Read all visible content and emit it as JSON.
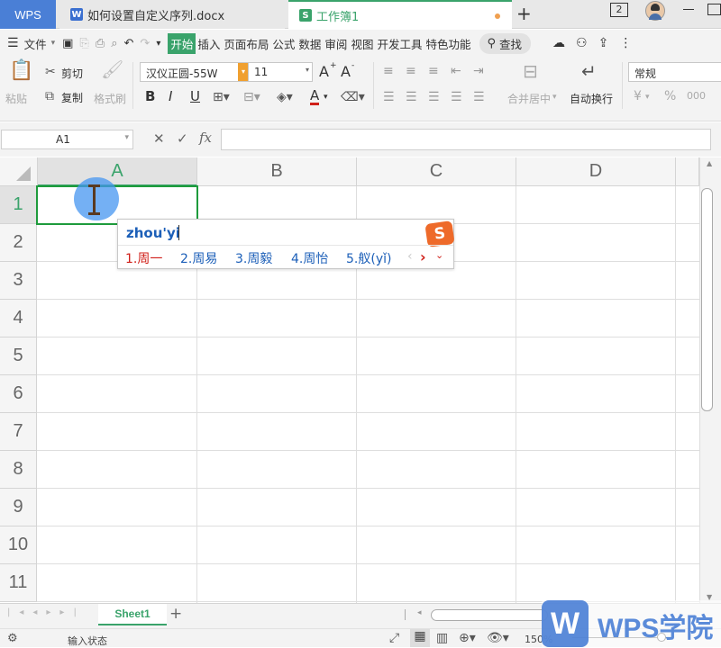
{
  "tabs": {
    "app": "WPS",
    "doc_icon": "W",
    "doc_title": "如何设置自定义序列.docx",
    "book_icon": "S",
    "book_title": "工作簿1",
    "new_tab": "+",
    "window_count": "2"
  },
  "menu": {
    "file": "文件",
    "items": [
      "开始",
      "插入",
      "页面布局",
      "公式",
      "数据",
      "审阅",
      "视图",
      "开发工具",
      "特色功能"
    ],
    "search": "查找"
  },
  "ribbon": {
    "paste": "粘贴",
    "cut": "剪切",
    "copy": "复制",
    "format_painter": "格式刷",
    "font_name": "汉仪正圆-55W",
    "font_size": "11",
    "bold": "B",
    "italic": "I",
    "underline": "U",
    "font_color_letter": "A",
    "merge_center": "合并居中",
    "wrap_text": "自动换行",
    "number_format": "常规",
    "currency": "¥",
    "percent": "%",
    "thousands": "000",
    "inc_font": "A",
    "dec_font": "A"
  },
  "formula_bar": {
    "name_box": "A1",
    "fx": "fx",
    "cancel": "✕",
    "confirm": "✓",
    "value": ""
  },
  "grid": {
    "columns": [
      "A",
      "B",
      "C",
      "D"
    ],
    "rows": [
      "1",
      "2",
      "3",
      "4",
      "5",
      "6",
      "7",
      "8",
      "9",
      "10",
      "11"
    ],
    "active_cell": "A1"
  },
  "ime": {
    "composition": "zhou'yi",
    "candidates": [
      "1.周一",
      "2.周易",
      "3.周毅",
      "4.周怡",
      "5.舣(yǐ)"
    ],
    "logo": "S"
  },
  "sheet_tabs": {
    "active": "Sheet1",
    "add": "+"
  },
  "status": {
    "mode": "输入状态",
    "zoom": "150%",
    "watermark": "WPS学院",
    "watermark_icon": "W"
  },
  "colors": {
    "accent_green": "#3aa36b",
    "wps_blue": "#4a7fd6",
    "ime_blue": "#1c5fb8",
    "ime_red": "#d0201a",
    "selection": "#1e9b3c"
  }
}
